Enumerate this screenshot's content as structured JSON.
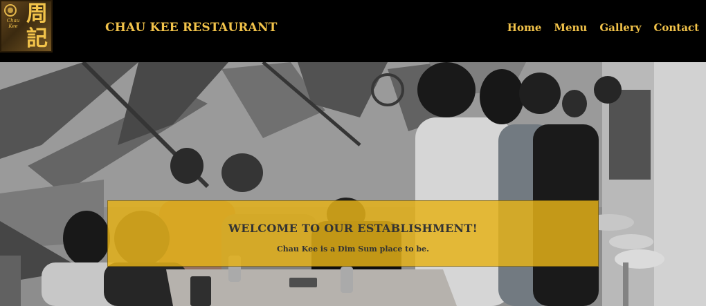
{
  "header": {
    "logo": {
      "chinese": "周記",
      "sub": "Chau Kee"
    },
    "brand": "CHAU KEE RESTAURANT",
    "nav": [
      "Home",
      "Menu",
      "Gallery",
      "Contact"
    ]
  },
  "hero": {
    "title": "WELCOME TO OUR ESTABLISHMENT!",
    "subtitle": "Chau Kee is a Dim Sum place to be."
  },
  "colors": {
    "accent": "#f2c34a",
    "banner": "#e5b118",
    "header_bg": "#000000"
  }
}
